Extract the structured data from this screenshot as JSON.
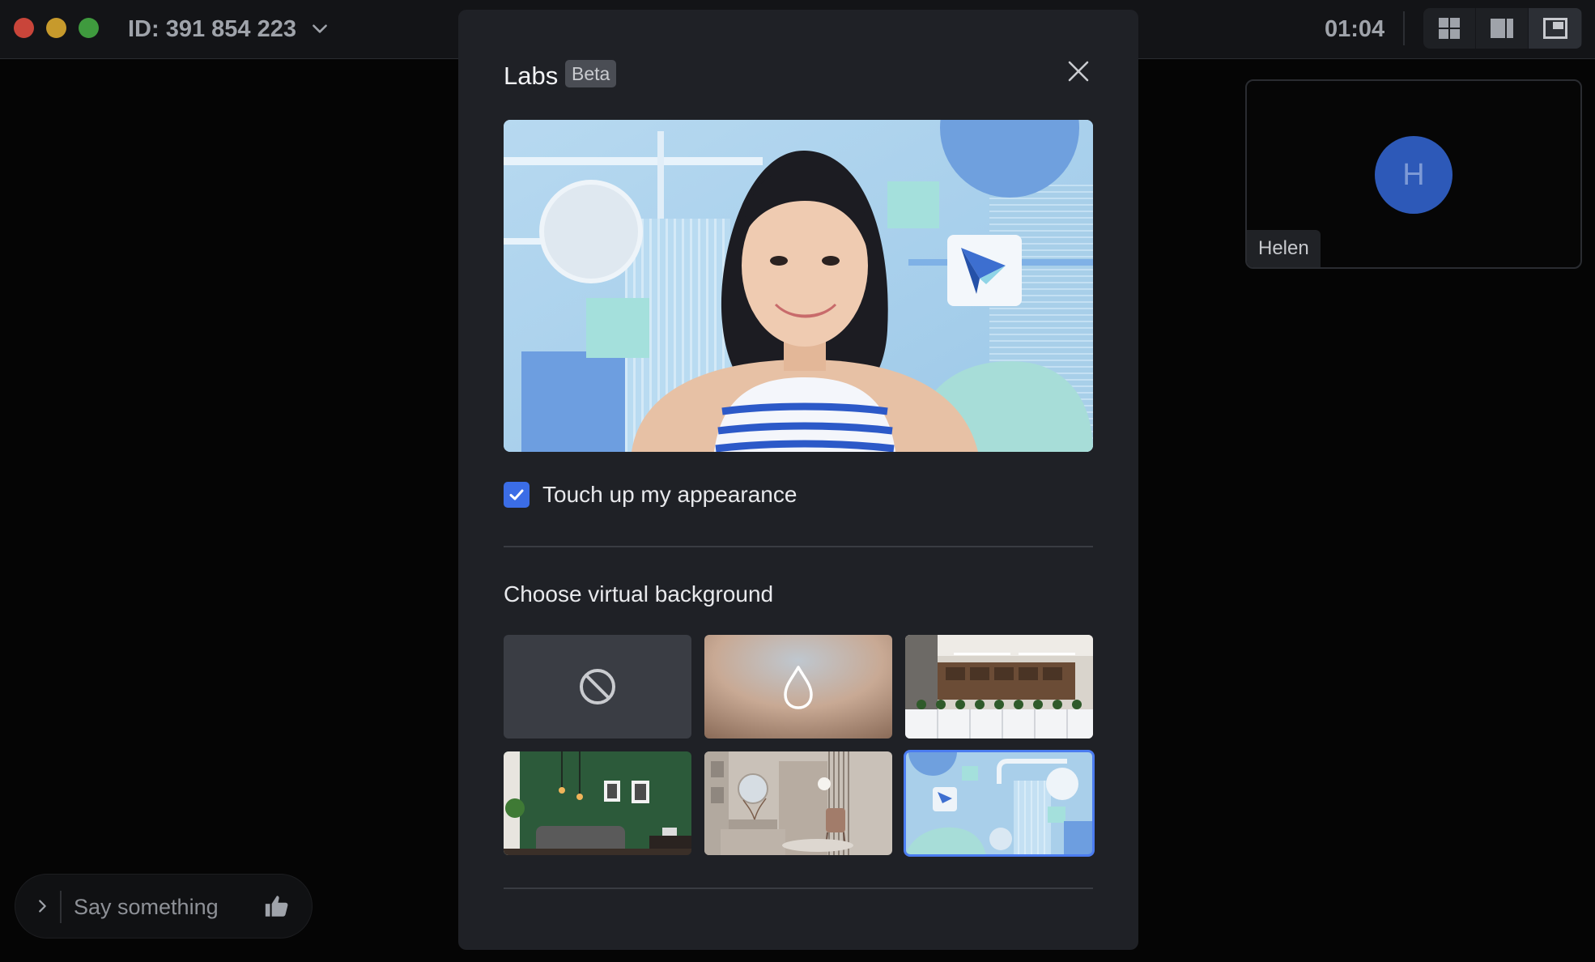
{
  "window": {
    "meeting_id": "ID: 391 854 223",
    "timer": "01:04"
  },
  "participant": {
    "initial": "H",
    "name": "Helen",
    "avatar_color": "#2d59b8"
  },
  "chat": {
    "placeholder": "Say something"
  },
  "modal": {
    "title": "Labs",
    "badge": "Beta",
    "touchup_label": "Touch up my appearance",
    "touchup_checked": true,
    "section_title": "Choose virtual background",
    "backgrounds": [
      {
        "id": "none",
        "icon": "no-background-icon"
      },
      {
        "id": "blur",
        "icon": "blur-drop-icon"
      },
      {
        "id": "office"
      },
      {
        "id": "green-living-room"
      },
      {
        "id": "beige-room"
      },
      {
        "id": "blue-abstract",
        "selected": true
      }
    ]
  },
  "colors": {
    "accent": "#3b6de6",
    "selected_border": "#4b7cf0",
    "modal_bg": "#1f2126",
    "traffic_red": "#c9453a",
    "traffic_yellow": "#c79a2c",
    "traffic_green": "#3f9a3e"
  }
}
